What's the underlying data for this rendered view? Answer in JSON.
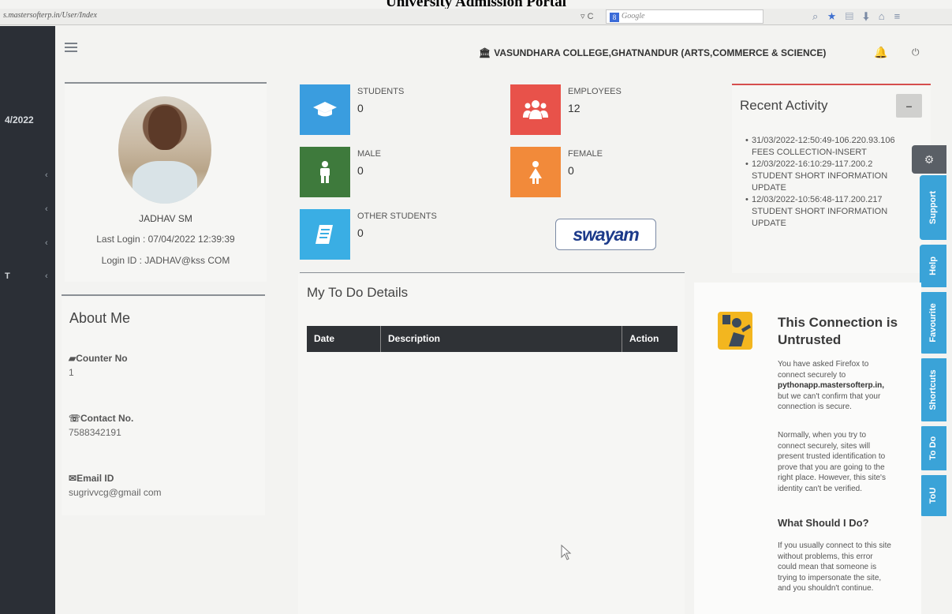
{
  "caption": "University Admission Portal",
  "browser": {
    "url": "s.mastersofterp.in/User/Index",
    "reload": "▿ C",
    "search_engine": "Google"
  },
  "sidebar": {
    "date_fragment": "4/2022",
    "items": [
      {
        "chevron": "‹"
      },
      {
        "chevron": "‹"
      },
      {
        "chevron": "‹"
      },
      {
        "letter": "T",
        "chevron": "‹"
      }
    ]
  },
  "header": {
    "college": "VASUNDHARA COLLEGE,GHATNANDUR (ARTS,COMMERCE & SCIENCE)",
    "bank_icon": "bank-icon",
    "bell_icon": "bell-icon",
    "power_icon": "power-icon"
  },
  "profile": {
    "name": "JADHAV SM",
    "last_login": "Last Login : 07/04/2022 12:39:39",
    "login_id": "Login ID : JADHAV@kss COM"
  },
  "about": {
    "title": "About Me",
    "counter_label": "Counter No",
    "counter_value": "1",
    "contact_label": "Contact No.",
    "contact_value": "7588342191",
    "email_label": "Email ID",
    "email_value": "sugrivvcg@gmail com"
  },
  "stats": [
    {
      "label": "STUDENTS",
      "value": "0",
      "color": "#3a9ddf",
      "icon": "graduation-cap-icon"
    },
    {
      "label": "EMPLOYEES",
      "value": "12",
      "color": "#e8524a",
      "icon": "users-icon"
    },
    {
      "label": "MALE",
      "value": "0",
      "color": "#3e7a3c",
      "icon": "male-icon"
    },
    {
      "label": "FEMALE",
      "value": "0",
      "color": "#f28a3a",
      "icon": "female-icon"
    },
    {
      "label": "OTHER STUDENTS",
      "value": "0",
      "color": "#3aaee4",
      "icon": "book-icon"
    }
  ],
  "swayam": {
    "logo": "swayam"
  },
  "todo": {
    "title": "My To Do Details",
    "columns": [
      "Date",
      "Description",
      "Action"
    ]
  },
  "activity": {
    "title": "Recent Activity",
    "minimize": "–",
    "items": [
      {
        "line1": "31/03/2022-12:50:49-106.220.93.106",
        "line2": "FEES COLLECTION-INSERT"
      },
      {
        "line1": "12/03/2022-16:10:29-117.200.2",
        "line2": "STUDENT SHORT INFORMATION",
        "line3": "UPDATE"
      },
      {
        "line1": "12/03/2022-10:56:48-117.200.217",
        "line2": "STUDENT SHORT INFORMATION",
        "line3": "UPDATE"
      }
    ]
  },
  "sidetabs": [
    "Support",
    "Help",
    "Favourite",
    "Shortcuts",
    "To Do",
    "ToU"
  ],
  "untrusted": {
    "title_line1": "This Connection is",
    "title_line2": "Untrusted",
    "p1a": "You have asked Firefox to",
    "p1b": "connect securely to",
    "p1host": "pythonapp.mastersofterp.in,",
    "p1c": "but we can't confirm that your",
    "p1d": "connection is secure.",
    "p2a": "Normally, when you try to",
    "p2b": "connect securely, sites will",
    "p2c": "present trusted identification to",
    "p2d": "prove that you are going to the",
    "p2e": "right place. However, this site's",
    "p2f": "identity can't be verified.",
    "subtitle": "What Should I Do?",
    "p3a": "If you usually connect to this site",
    "p3b": "without problems, this error",
    "p3c": "could mean that someone is",
    "p3d": "trying to impersonate the site,",
    "p3e": "and you shouldn't continue."
  },
  "colors": {
    "sidebar": "#2b2f36",
    "table_header": "#2f3236",
    "tab_blue": "#3aa3d8",
    "activity_border": "#d64e4e"
  }
}
